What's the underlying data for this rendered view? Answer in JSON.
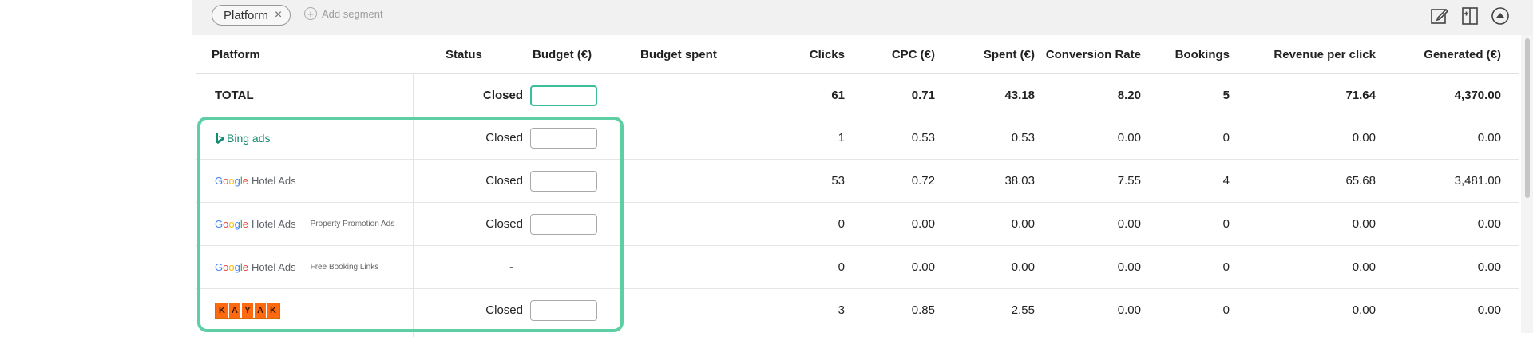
{
  "toolbar": {
    "segment_chip": "Platform",
    "add_segment": "Add segment"
  },
  "columns": [
    "Platform",
    "Status",
    "Budget (€)",
    "Budget spent",
    "Clicks",
    "CPC (€)",
    "Spent (€)",
    "Conversion Rate",
    "Bookings",
    "Revenue per click",
    "Generated (€)"
  ],
  "total": {
    "label": "TOTAL",
    "status": "Closed",
    "clicks": "61",
    "cpc": "0.71",
    "spent": "43.18",
    "conv": "8.20",
    "bookings": "5",
    "rpc": "71.64",
    "generated": "4,370.00"
  },
  "rows": [
    {
      "platform_logo": "bing-ads",
      "logo_text": "Bing ads",
      "status": "Closed",
      "clicks": "1",
      "cpc": "0.53",
      "spent": "0.53",
      "conv": "0.00",
      "bookings": "0",
      "rpc": "0.00",
      "generated": "0.00"
    },
    {
      "platform_logo": "google-hotel-ads",
      "logo_text": "Hotel Ads",
      "sub": "",
      "status": "Closed",
      "clicks": "53",
      "cpc": "0.72",
      "spent": "38.03",
      "conv": "7.55",
      "bookings": "4",
      "rpc": "65.68",
      "generated": "3,481.00"
    },
    {
      "platform_logo": "google-hotel-ads",
      "logo_text": "Hotel Ads",
      "sub": "Property Promotion Ads",
      "status": "Closed",
      "clicks": "0",
      "cpc": "0.00",
      "spent": "0.00",
      "conv": "0.00",
      "bookings": "0",
      "rpc": "0.00",
      "generated": "0.00"
    },
    {
      "platform_logo": "google-hotel-ads",
      "logo_text": "Hotel Ads",
      "sub": "Free Booking Links",
      "status": "-",
      "clicks": "0",
      "cpc": "0.00",
      "spent": "0.00",
      "conv": "0.00",
      "bookings": "0",
      "rpc": "0.00",
      "generated": "0.00"
    },
    {
      "platform_logo": "kayak",
      "logo_text": "KAYAK",
      "status": "Closed",
      "clicks": "3",
      "cpc": "0.85",
      "spent": "2.55",
      "conv": "0.00",
      "bookings": "0",
      "rpc": "0.00",
      "generated": "0.00"
    }
  ],
  "colors": {
    "accent": "#5ecfa5",
    "focus": "#3bbf9a"
  },
  "icons": [
    "edit-icon",
    "split-column-icon",
    "collapse-up-icon",
    "close-icon",
    "plus-circle-icon"
  ]
}
